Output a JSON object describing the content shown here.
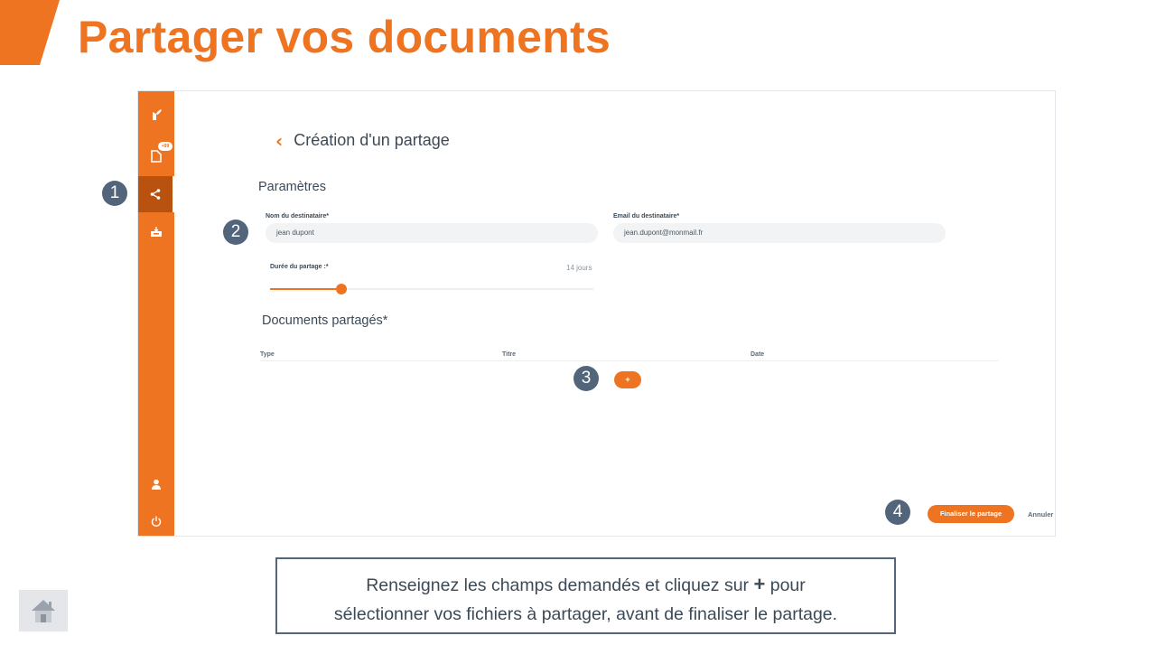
{
  "colors": {
    "accent": "#ee7421",
    "accent_dark": "#b9520f",
    "step_badge": "#52657a",
    "text": "#3b4957"
  },
  "page": {
    "title": "Partager vos documents"
  },
  "sidebar": {
    "items": [
      {
        "icon": "leaf-logo-icon"
      },
      {
        "icon": "document-icon",
        "badge": "+99"
      },
      {
        "icon": "share-icon",
        "active": true
      },
      {
        "icon": "inbox-icon"
      },
      {
        "icon": "user-icon"
      },
      {
        "icon": "power-icon"
      }
    ]
  },
  "header": {
    "back_icon": "chevron-left-icon",
    "title": "Création d'un partage"
  },
  "params": {
    "section_title": "Paramètres",
    "recipient_name": {
      "label": "Nom du destinataire*",
      "value": "jean dupont"
    },
    "recipient_email": {
      "label": "Email du destinataire*",
      "value": "jean.dupont@monmail.fr"
    },
    "duration": {
      "label": "Durée du partage :*",
      "value_label": "14 jours",
      "fraction": 0.22
    }
  },
  "documents": {
    "section_title": "Documents partagés*",
    "columns": [
      "Type",
      "Titre",
      "Date"
    ],
    "add_label": "+"
  },
  "actions": {
    "finalize": "Finaliser le partage",
    "cancel": "Annuler"
  },
  "steps": [
    "1",
    "2",
    "3",
    "4"
  ],
  "caption": {
    "line1_before": "Renseignez les champs demandés et cliquez sur",
    "plus": "+",
    "line1_after": "pour",
    "line2": "sélectionner vos fichiers à partager, avant de finaliser le partage."
  },
  "nav": {
    "home_icon": "home-icon"
  }
}
